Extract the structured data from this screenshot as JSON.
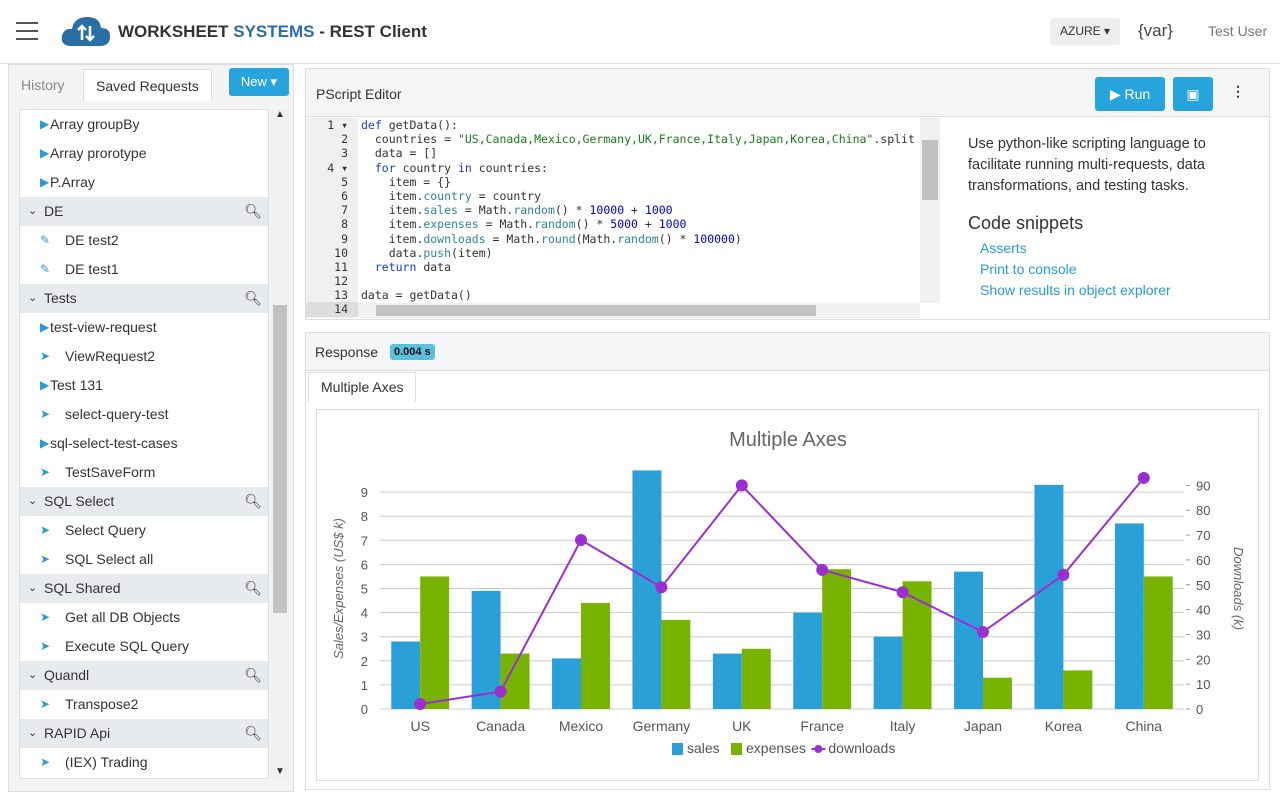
{
  "header": {
    "brand_main": "WORKSHEET",
    "brand_accent": "SYSTEMS",
    "brand_suffix": "- REST Client",
    "env": "AZURE",
    "var_label": "{var}",
    "user": "Test User"
  },
  "sidebar": {
    "tabs": [
      "History",
      "Saved Requests"
    ],
    "new_label": "New",
    "entries": [
      {
        "type": "item",
        "icon": "play-icon",
        "label": "Array groupBy"
      },
      {
        "type": "item",
        "icon": "play-icon",
        "label": "Array prorotype"
      },
      {
        "type": "item",
        "icon": "play-icon",
        "label": "P.Array"
      },
      {
        "type": "group",
        "label": "DE"
      },
      {
        "type": "item",
        "icon": "edit-icon",
        "label": "DE test2"
      },
      {
        "type": "item",
        "icon": "edit-icon",
        "label": "DE test1"
      },
      {
        "type": "group",
        "label": "Tests"
      },
      {
        "type": "item",
        "icon": "play-icon",
        "label": "test-view-request"
      },
      {
        "type": "item",
        "icon": "send-icon",
        "label": "ViewRequest2"
      },
      {
        "type": "item",
        "icon": "play-icon",
        "label": "Test 131"
      },
      {
        "type": "item",
        "icon": "send-icon",
        "label": "select-query-test"
      },
      {
        "type": "item",
        "icon": "play-icon",
        "label": "sql-select-test-cases"
      },
      {
        "type": "item",
        "icon": "send-icon",
        "label": "TestSaveForm"
      },
      {
        "type": "group",
        "label": "SQL Select"
      },
      {
        "type": "item",
        "icon": "send-icon",
        "label": "Select Query"
      },
      {
        "type": "item",
        "icon": "send-icon",
        "label": "SQL Select all"
      },
      {
        "type": "group",
        "label": "SQL Shared"
      },
      {
        "type": "item",
        "icon": "send-icon",
        "label": "Get all DB Objects"
      },
      {
        "type": "item",
        "icon": "send-icon",
        "label": "Execute SQL Query"
      },
      {
        "type": "group",
        "label": "Quandl"
      },
      {
        "type": "item",
        "icon": "send-icon",
        "label": "Transpose2"
      },
      {
        "type": "group",
        "label": "RAPID Api"
      },
      {
        "type": "item",
        "icon": "send-icon",
        "label": "(IEX) Trading"
      }
    ]
  },
  "editor": {
    "title": "PScript Editor",
    "run_label": "Run",
    "lines": [
      "def getData():",
      "  countries = \"US,Canada,Mexico,Germany,UK,France,Italy,Japan,Korea,China\".split",
      "  data = []",
      "  for country in countries:",
      "    item = {}",
      "    item.country = country",
      "    item.sales = Math.random() * 10000 + 1000",
      "    item.expenses = Math.random() * 5000 + 1000",
      "    item.downloads = Math.round(Math.random() * 100000)",
      "    data.push(item)",
      "  return data",
      "",
      "data = getData()",
      ""
    ],
    "help_text": "Use python-like scripting language to facilitate running multi-requests, data transformations, and testing tasks.",
    "snippets_title": "Code snippets",
    "snippets": [
      "Asserts",
      "Print to console",
      "Show results in object explorer"
    ]
  },
  "response": {
    "label": "Response",
    "time": "0.004 s",
    "tab": "Multiple Axes"
  },
  "chart_data": {
    "type": "bar+line",
    "title": "Multiple Axes",
    "categories": [
      "US",
      "Canada",
      "Mexico",
      "Germany",
      "UK",
      "France",
      "Italy",
      "Japan",
      "Korea",
      "China"
    ],
    "series": [
      {
        "name": "sales",
        "type": "bar",
        "axis": "left",
        "color": "#2b9fd8",
        "values": [
          2.8,
          4.9,
          2.1,
          9.9,
          2.3,
          4.0,
          3.0,
          5.7,
          9.3,
          7.7
        ]
      },
      {
        "name": "expenses",
        "type": "bar",
        "axis": "left",
        "color": "#77b300",
        "values": [
          5.5,
          2.3,
          4.4,
          3.7,
          2.5,
          5.8,
          5.3,
          1.3,
          1.6,
          5.5
        ]
      },
      {
        "name": "downloads",
        "type": "line",
        "axis": "right",
        "color": "#9b30d0",
        "values": [
          2,
          7,
          68,
          49,
          90,
          56,
          47,
          31,
          54,
          93
        ]
      }
    ],
    "ylabel": "Sales/Expenses (US$ k)",
    "y2label": "Downloads (k)",
    "ylim": [
      0,
      10
    ],
    "yticks": [
      0,
      1,
      2,
      3,
      4,
      5,
      6,
      7,
      8,
      9
    ],
    "y2lim": [
      0,
      97
    ],
    "y2ticks": [
      0,
      10,
      20,
      30,
      40,
      50,
      60,
      70,
      80,
      90
    ],
    "grid": true,
    "legend": "bottom"
  }
}
